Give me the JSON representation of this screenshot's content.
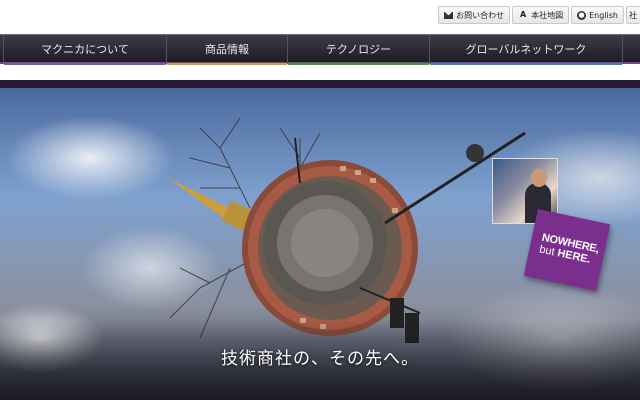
{
  "utility": {
    "contact_label": "お問い合わせ",
    "sitemap_label": "本社地図",
    "english_label": "English",
    "extra_label": "社",
    "contact_icon": "mail-icon",
    "sitemap_icon": "letter-a-icon",
    "english_icon": "globe-icon"
  },
  "nav": {
    "items": [
      {
        "label": "マクニカについて",
        "accent": "#7a5aa0"
      },
      {
        "label": "商品情報",
        "accent": "#c9a23a"
      },
      {
        "label": "テクノロジー",
        "accent": "#4a9a3a"
      },
      {
        "label": "グローバルネットワーク",
        "accent": "#4a7ab0"
      }
    ]
  },
  "hero": {
    "tagline": "技術商社の、その先へ。",
    "badge": {
      "line1": "NOWHERE,",
      "line2_prefix": "but ",
      "line2_bold": "HERE."
    }
  }
}
